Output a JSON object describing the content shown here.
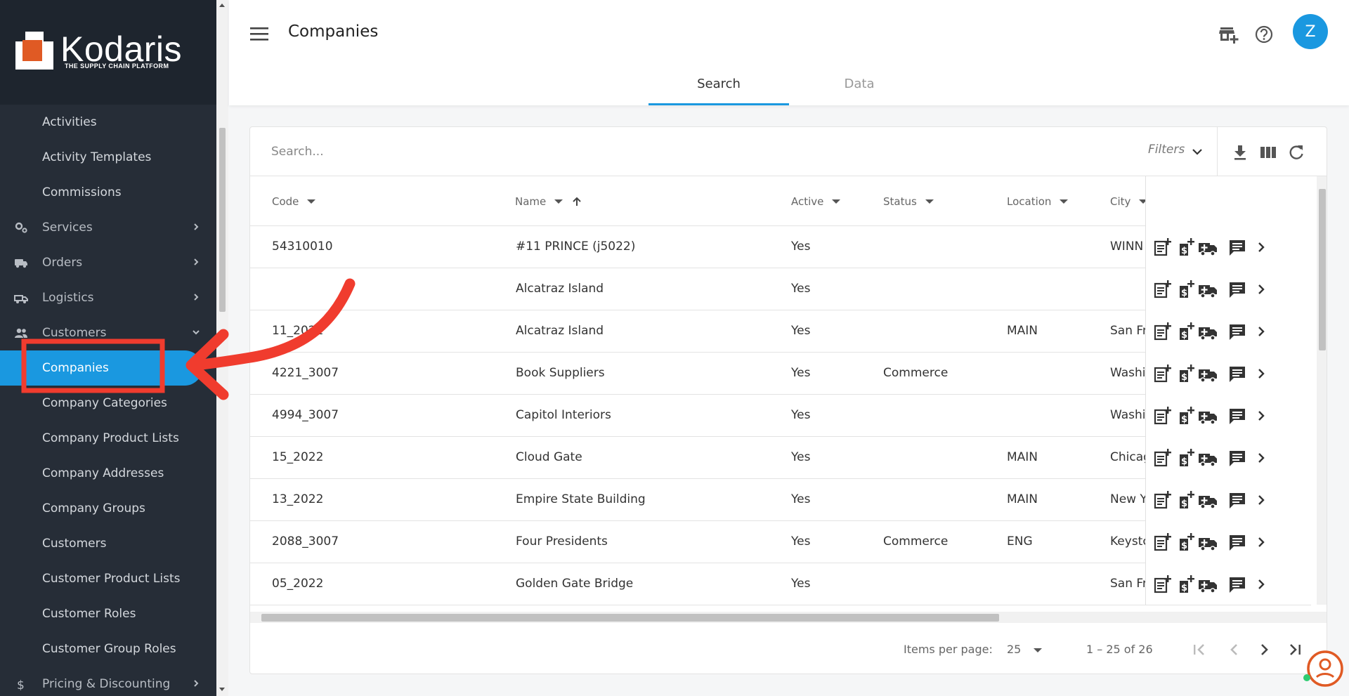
{
  "app": {
    "brand": "Kodaris",
    "tagline": "THE SUPPLY CHAIN PLATFORM"
  },
  "sidebar": {
    "items": [
      {
        "label": "Activities",
        "type": "child"
      },
      {
        "label": "Activity Templates",
        "type": "child"
      },
      {
        "label": "Commissions",
        "type": "child"
      },
      {
        "label": "Services",
        "type": "parent",
        "icon": "gears-icon"
      },
      {
        "label": "Orders",
        "type": "parent",
        "icon": "truck-icon"
      },
      {
        "label": "Logistics",
        "type": "parent",
        "icon": "delivery-truck-icon"
      },
      {
        "label": "Customers",
        "type": "parent",
        "icon": "people-icon",
        "expanded": true
      },
      {
        "label": "Companies",
        "type": "child",
        "active": true
      },
      {
        "label": "Company Categories",
        "type": "child"
      },
      {
        "label": "Company Product Lists",
        "type": "child"
      },
      {
        "label": "Company Addresses",
        "type": "child"
      },
      {
        "label": "Company Groups",
        "type": "child"
      },
      {
        "label": "Customers",
        "type": "child"
      },
      {
        "label": "Customer Product Lists",
        "type": "child"
      },
      {
        "label": "Customer Roles",
        "type": "child"
      },
      {
        "label": "Customer Group Roles",
        "type": "child"
      },
      {
        "label": "Pricing & Discounting",
        "type": "parent",
        "icon": "dollar-icon"
      }
    ]
  },
  "header": {
    "title": "Companies",
    "avatar_initial": "Z",
    "tabs": [
      {
        "label": "Search",
        "active": true
      },
      {
        "label": "Data",
        "active": false
      }
    ]
  },
  "toolbar": {
    "search_placeholder": "Search...",
    "filters_label": "Filters"
  },
  "table": {
    "columns": [
      "Code",
      "Name",
      "Active",
      "Status",
      "Location",
      "City"
    ],
    "rows": [
      {
        "code": "54310010",
        "name": "#11 PRINCE (j5022)",
        "active": "Yes",
        "status": "",
        "location": "",
        "city": "WINN"
      },
      {
        "code": "",
        "name": "Alcatraz Island",
        "active": "Yes",
        "status": "",
        "location": "",
        "city": ""
      },
      {
        "code": "11_2022",
        "name": "Alcatraz Island",
        "active": "Yes",
        "status": "",
        "location": "MAIN",
        "city": "San Fr"
      },
      {
        "code": "4221_3007",
        "name": "Book Suppliers",
        "active": "Yes",
        "status": "Commerce",
        "location": "",
        "city": "Washi"
      },
      {
        "code": "4994_3007",
        "name": "Capitol Interiors",
        "active": "Yes",
        "status": "",
        "location": "",
        "city": "Washi"
      },
      {
        "code": "15_2022",
        "name": "Cloud Gate",
        "active": "Yes",
        "status": "",
        "location": "MAIN",
        "city": "Chicag"
      },
      {
        "code": "13_2022",
        "name": "Empire State Building",
        "active": "Yes",
        "status": "",
        "location": "MAIN",
        "city": "New Y"
      },
      {
        "code": "2088_3007",
        "name": "Four Presidents",
        "active": "Yes",
        "status": "Commerce",
        "location": "ENG",
        "city": "Keystc"
      },
      {
        "code": "05_2022",
        "name": "Golden Gate Bridge",
        "active": "Yes",
        "status": "",
        "location": "",
        "city": "San Fr"
      }
    ],
    "row_actions": [
      "add-note-icon",
      "add-price-icon",
      "add-shipment-icon",
      "comment-icon",
      "chevron-right-icon"
    ]
  },
  "paginator": {
    "items_per_page_label": "Items per page:",
    "items_per_page": "25",
    "range": "1 – 25 of 26"
  },
  "colors": {
    "sidebar_bg": "#262d37",
    "accent": "#1a98e0",
    "annotation": "#f03c2e",
    "logo_orange": "#e05a24"
  }
}
